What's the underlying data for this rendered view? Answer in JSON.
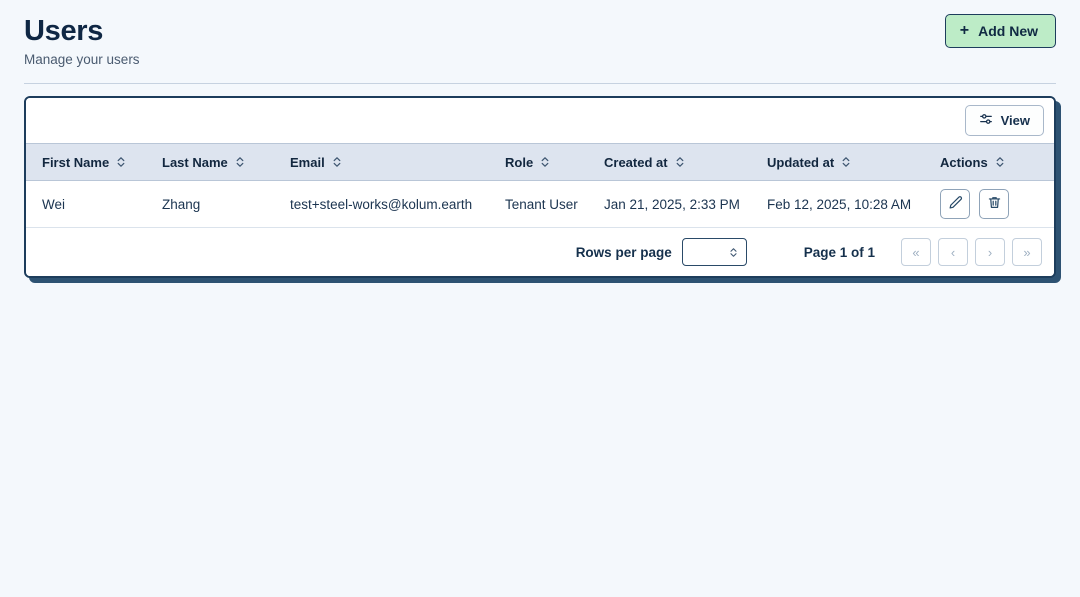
{
  "header": {
    "title": "Users",
    "subtitle": "Manage your users",
    "add_new_label": "Add New",
    "add_new_icon": "plus-icon",
    "add_new_bg": "#bdecc7",
    "add_new_border": "#1d3d5c"
  },
  "toolbar": {
    "view_label": "View",
    "view_icon": "sliders-icon"
  },
  "table": {
    "columns": [
      {
        "label": "First Name",
        "sort_icon": "sort-chevrons-icon"
      },
      {
        "label": "Last Name",
        "sort_icon": "sort-chevrons-icon"
      },
      {
        "label": "Email",
        "sort_icon": "sort-chevrons-icon"
      },
      {
        "label": "Role",
        "sort_icon": "sort-chevrons-icon"
      },
      {
        "label": "Created at",
        "sort_icon": "sort-chevrons-icon"
      },
      {
        "label": "Updated at",
        "sort_icon": "sort-chevrons-icon"
      },
      {
        "label": "Actions",
        "sort_icon": "sort-chevrons-icon"
      }
    ],
    "rows": [
      {
        "first_name": "Wei",
        "last_name": "Zhang",
        "email": "test+steel-works@kolum.earth",
        "role": "Tenant User",
        "created_at": "Jan 21, 2025, 2:33 PM",
        "updated_at": "Feb 12, 2025, 10:28 AM",
        "edit_icon": "pencil-icon",
        "delete_icon": "trash-icon"
      }
    ]
  },
  "footer": {
    "rows_per_page_label": "Rows per page",
    "rows_per_page_value": "",
    "page_indicator": "Page 1 of 1",
    "pager": [
      {
        "label": "«",
        "name": "first-page-button"
      },
      {
        "label": "‹",
        "name": "previous-page-button"
      },
      {
        "label": "›",
        "name": "next-page-button"
      },
      {
        "label": "»",
        "name": "last-page-button"
      }
    ]
  },
  "colors": {
    "page_bg": "#f4f8fc",
    "card_border": "#1d3d5c",
    "card_shadow": "#2d5272",
    "thead_bg": "#dde4ef",
    "title": "#0f2744"
  }
}
